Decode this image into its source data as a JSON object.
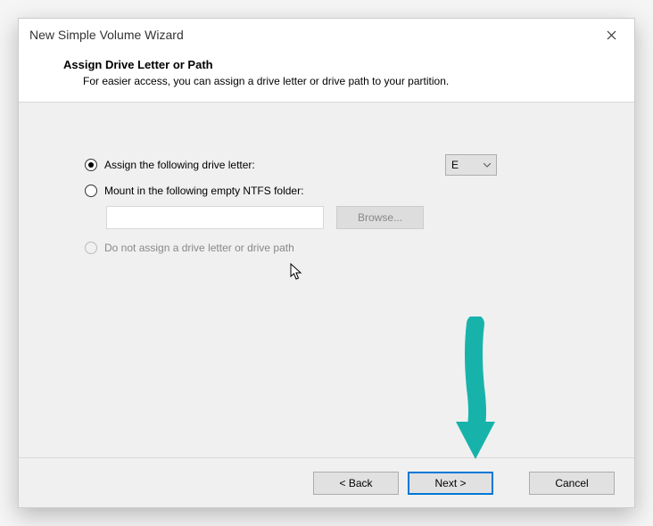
{
  "window": {
    "title": "New Simple Volume Wizard"
  },
  "header": {
    "heading": "Assign Drive Letter or Path",
    "subtext": "For easier access, you can assign a drive letter or drive path to your partition."
  },
  "options": {
    "assign": {
      "label": "Assign the following drive letter:",
      "selected": true
    },
    "mount": {
      "label": "Mount in the following empty NTFS folder:",
      "selected": false
    },
    "none": {
      "label": "Do not assign a drive letter or drive path",
      "disabled": true
    }
  },
  "drive_letter": "E",
  "path_value": "",
  "browse_label": "Browse...",
  "footer": {
    "back": "< Back",
    "next": "Next >",
    "cancel": "Cancel"
  }
}
